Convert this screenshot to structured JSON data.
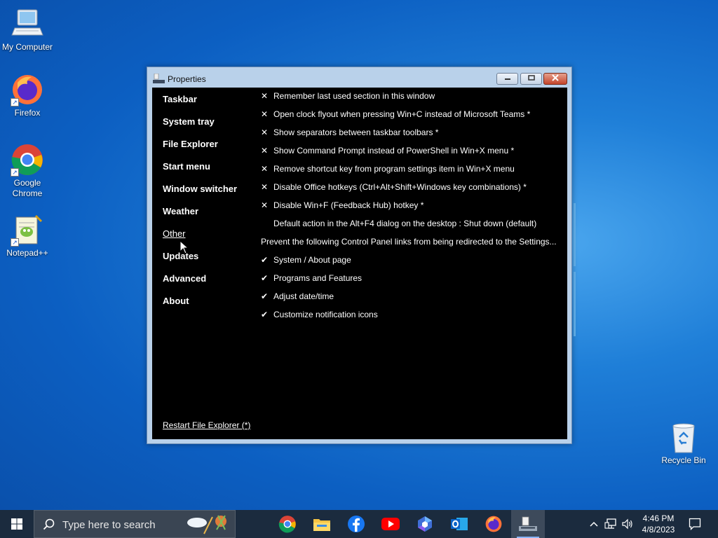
{
  "desktop": {
    "icons": [
      {
        "label": "My Computer"
      },
      {
        "label": "Firefox"
      },
      {
        "label": "Google Chrome"
      },
      {
        "label": "Notepad++"
      },
      {
        "label": "Recycle Bin"
      }
    ]
  },
  "window": {
    "title": "Properties",
    "nav": [
      {
        "label": "Taskbar"
      },
      {
        "label": "System tray"
      },
      {
        "label": "File Explorer"
      },
      {
        "label": "Start menu"
      },
      {
        "label": "Window switcher"
      },
      {
        "label": "Weather"
      },
      {
        "label": "Other",
        "active": true
      },
      {
        "label": "Updates"
      },
      {
        "label": "Advanced"
      },
      {
        "label": "About"
      }
    ],
    "options": [
      {
        "mark": "✕",
        "label": "Remember last used section in this window"
      },
      {
        "mark": "✕",
        "label": "Open clock flyout when pressing Win+C instead of Microsoft Teams *"
      },
      {
        "mark": "✕",
        "label": "Show separators between taskbar toolbars *"
      },
      {
        "mark": "✕",
        "label": "Show Command Prompt instead of PowerShell in Win+X menu *"
      },
      {
        "mark": "✕",
        "label": "Remove shortcut key from program settings item in Win+X menu"
      },
      {
        "mark": "✕",
        "label": "Disable Office hotkeys (Ctrl+Alt+Shift+Windows key combinations) *"
      },
      {
        "mark": "✕",
        "label": "Disable Win+F (Feedback Hub) hotkey *"
      },
      {
        "mark": "",
        "label": "Default action in the Alt+F4 dialog on the desktop : Shut down (default)"
      },
      {
        "mark": "",
        "label": "Prevent the following Control Panel links from being redirected to the Settings...",
        "header": true
      },
      {
        "mark": "✔",
        "label": "System / About page"
      },
      {
        "mark": "✔",
        "label": "Programs and Features"
      },
      {
        "mark": "✔",
        "label": "Adjust date/time"
      },
      {
        "mark": "✔",
        "label": "Customize notification icons"
      }
    ],
    "restart_label": "Restart File Explorer (*)"
  },
  "taskbar": {
    "search_placeholder": "Type here to search",
    "apps": [
      "chrome-icon",
      "file-explorer-icon",
      "facebook-icon",
      "youtube-icon",
      "copilot-icon",
      "outlook-icon",
      "firefox-icon",
      "properties-app-icon"
    ],
    "time": "4:46 PM",
    "date": "4/8/2023"
  },
  "colors": {
    "taskbar": "#1b2b3e",
    "window_frame": "#b9d1ea",
    "client_bg": "#000000"
  }
}
